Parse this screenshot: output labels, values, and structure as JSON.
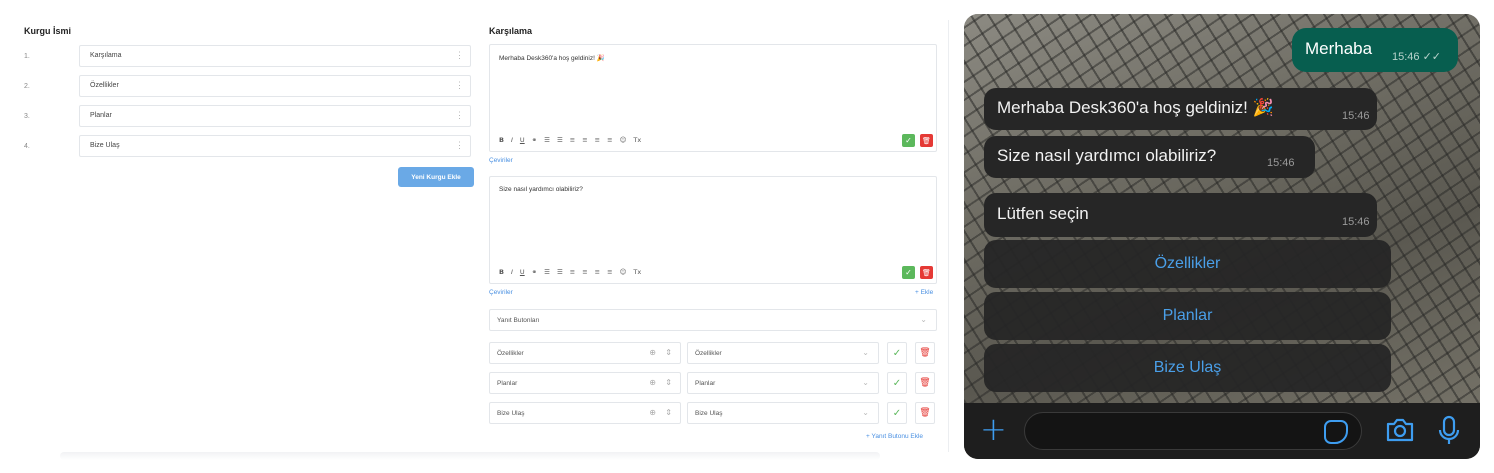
{
  "left": {
    "title": "Kurgu İsmi",
    "rows": [
      {
        "num": "1.",
        "value": "Karşılama"
      },
      {
        "num": "2.",
        "value": "Özellikler"
      },
      {
        "num": "3.",
        "value": "Planlar"
      },
      {
        "num": "4.",
        "value": "Bize Ulaş"
      }
    ],
    "new_button": "Yeni Kurgu Ekle"
  },
  "middle": {
    "title": "Karşılama",
    "editors": [
      {
        "text": "Merhaba Desk360'a hoş geldiniz! 🎉"
      },
      {
        "text": "Size nasıl yardımcı olabiliriz?"
      }
    ],
    "toolbar_glyphs": [
      "B",
      "I",
      "U",
      "⚭",
      "☰",
      "☰",
      "≡",
      "≡",
      "≡",
      "≡",
      "☺",
      "Tx"
    ],
    "translations_link": "Çeviriler",
    "add_link": "+ Ekle",
    "reply_buttons_select": "Yanıt Butonları",
    "reply_buttons": [
      {
        "label": "Özellikler",
        "target": "Özellikler"
      },
      {
        "label": "Planlar",
        "target": "Planlar"
      },
      {
        "label": "Bize Ulaş",
        "target": "Bize Ulaş"
      }
    ],
    "add_reply_button": "+ Yanıt Butonu Ekle"
  },
  "chat": {
    "outgoing": {
      "text": "Merhaba",
      "time": "15:46 ✓✓"
    },
    "incoming": [
      {
        "text": "Merhaba Desk360'a hoş geldiniz! 🎉",
        "time": "15:46"
      },
      {
        "text": "Size nasıl yardımcı olabiliriz?",
        "time": "15:46"
      },
      {
        "text": "Lütfen seçin",
        "time": "15:46"
      }
    ],
    "reply_buttons": [
      "Özellikler",
      "Planlar",
      "Bize Ulaş"
    ],
    "icons": [
      "plus-icon",
      "sticker-icon",
      "camera-icon",
      "microphone-icon"
    ],
    "accent": "#3e9df0",
    "outgoing_color": "#075e4f"
  }
}
